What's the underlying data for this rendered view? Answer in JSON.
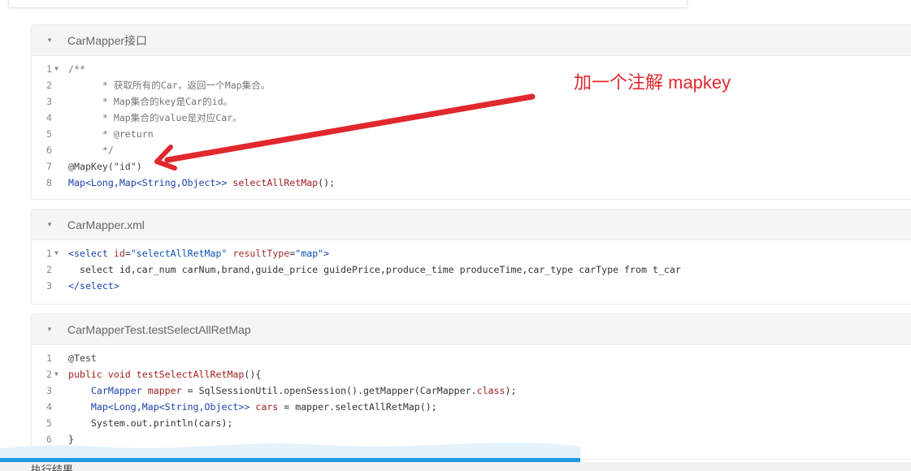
{
  "annotation": {
    "text": "加一个注解 mapkey"
  },
  "blocks": [
    {
      "title": "CarMapper接口",
      "lines": [
        {
          "n": "1",
          "fold": true,
          "segs": [
            {
              "t": "/**",
              "c": "comment"
            }
          ]
        },
        {
          "n": "2",
          "segs": [
            {
              "t": "      * 获取所有的Car，返回一个Map集合。",
              "c": "comment"
            }
          ]
        },
        {
          "n": "3",
          "segs": [
            {
              "t": "      * Map集合的key是Car的id。",
              "c": "comment"
            }
          ]
        },
        {
          "n": "4",
          "segs": [
            {
              "t": "      * Map集合的value是对应Car。",
              "c": "comment"
            }
          ]
        },
        {
          "n": "5",
          "segs": [
            {
              "t": "      * @return",
              "c": "comment"
            }
          ]
        },
        {
          "n": "6",
          "segs": [
            {
              "t": "      */",
              "c": "comment"
            }
          ]
        },
        {
          "n": "7",
          "segs": [
            {
              "t": "@MapKey(\"id\")",
              "c": "anno"
            }
          ]
        },
        {
          "n": "8",
          "segs": [
            {
              "t": "Map<Long,Map<String,Object>>",
              "c": "type"
            },
            {
              "t": " ",
              "c": "plain"
            },
            {
              "t": "selectAllRetMap",
              "c": "kw"
            },
            {
              "t": "();",
              "c": "plain"
            }
          ]
        }
      ]
    },
    {
      "title": "CarMapper.xml",
      "lines": [
        {
          "n": "1",
          "fold": true,
          "segs": [
            {
              "t": "<select",
              "c": "tag"
            },
            {
              "t": " id",
              "c": "attr"
            },
            {
              "t": "=",
              "c": "plain"
            },
            {
              "t": "\"selectAllRetMap\"",
              "c": "str"
            },
            {
              "t": " resultType",
              "c": "attr"
            },
            {
              "t": "=",
              "c": "plain"
            },
            {
              "t": "\"map\"",
              "c": "str"
            },
            {
              "t": ">",
              "c": "tag"
            }
          ]
        },
        {
          "n": "2",
          "segs": [
            {
              "t": "  select id,car_num carNum,brand,guide_price guidePrice,produce_time produceTime,car_type carType from t_car",
              "c": "plain"
            }
          ]
        },
        {
          "n": "3",
          "segs": [
            {
              "t": "</select>",
              "c": "tag"
            }
          ]
        }
      ]
    },
    {
      "title": "CarMapperTest.testSelectAllRetMap",
      "lines": [
        {
          "n": "1",
          "segs": [
            {
              "t": "@Test",
              "c": "anno"
            }
          ]
        },
        {
          "n": "2",
          "fold": true,
          "segs": [
            {
              "t": "public void",
              "c": "kw"
            },
            {
              "t": " ",
              "c": "plain"
            },
            {
              "t": "testSelectAllRetMap",
              "c": "kw"
            },
            {
              "t": "(){",
              "c": "plain"
            }
          ]
        },
        {
          "n": "3",
          "segs": [
            {
              "t": "    CarMapper",
              "c": "type"
            },
            {
              "t": " ",
              "c": "plain"
            },
            {
              "t": "mapper",
              "c": "kw"
            },
            {
              "t": " = SqlSessionUtil.openSession().getMapper(CarMapper.",
              "c": "plain"
            },
            {
              "t": "class",
              "c": "kw"
            },
            {
              "t": ");",
              "c": "plain"
            }
          ]
        },
        {
          "n": "4",
          "segs": [
            {
              "t": "    Map<Long,Map<String,Object>>",
              "c": "type"
            },
            {
              "t": " ",
              "c": "plain"
            },
            {
              "t": "cars",
              "c": "kw"
            },
            {
              "t": " = mapper.selectAllRetMap();",
              "c": "plain"
            }
          ]
        },
        {
          "n": "5",
          "segs": [
            {
              "t": "    System.out.println(cars);",
              "c": "plain"
            }
          ]
        },
        {
          "n": "6",
          "segs": [
            {
              "t": "}",
              "c": "plain"
            }
          ]
        }
      ]
    }
  ],
  "bottom": {
    "label": "执行结果"
  },
  "colors": {
    "annotation": "#e0282d",
    "progress": "#1e9be0"
  }
}
